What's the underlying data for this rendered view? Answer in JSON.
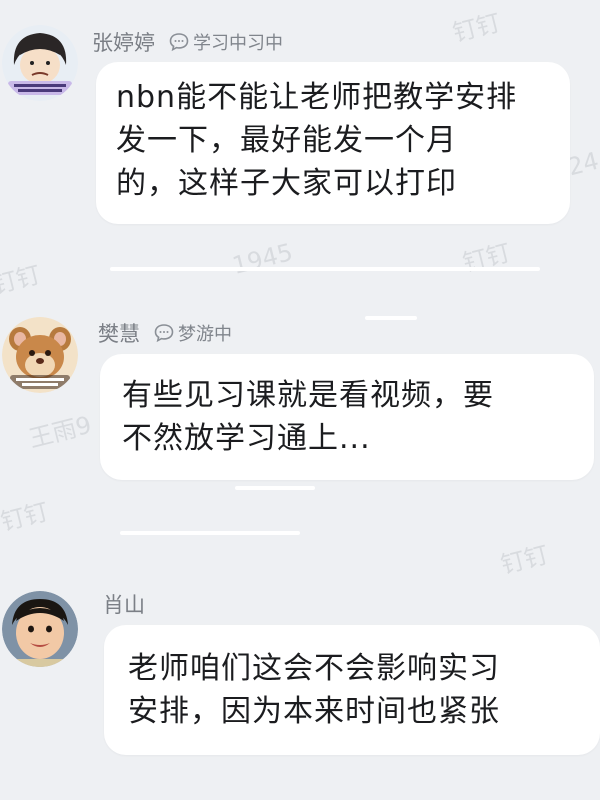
{
  "watermarks": [
    "钉钉",
    "钉钉",
    "钉钉",
    "钉钉",
    "钉钉",
    "钉钉",
    "王雨9",
    "24",
    "1945"
  ],
  "messages": [
    {
      "sender": "张婷婷",
      "status": "学习中习中",
      "status_icon": "chat-bubble-icon",
      "text": "nbn能不能让老师把教学安排\n发一下，最好能发一个月\n的，这样子大家可以打印"
    },
    {
      "sender": "樊慧",
      "status": "梦游中",
      "status_icon": "chat-bubble-icon",
      "text": "有些见习课就是看视频，要\n不然放学习通上..."
    },
    {
      "sender": "肖山",
      "status": "",
      "text": "老师咱们这会不会影响实习\n安排，因为本来时间也紧张"
    }
  ]
}
